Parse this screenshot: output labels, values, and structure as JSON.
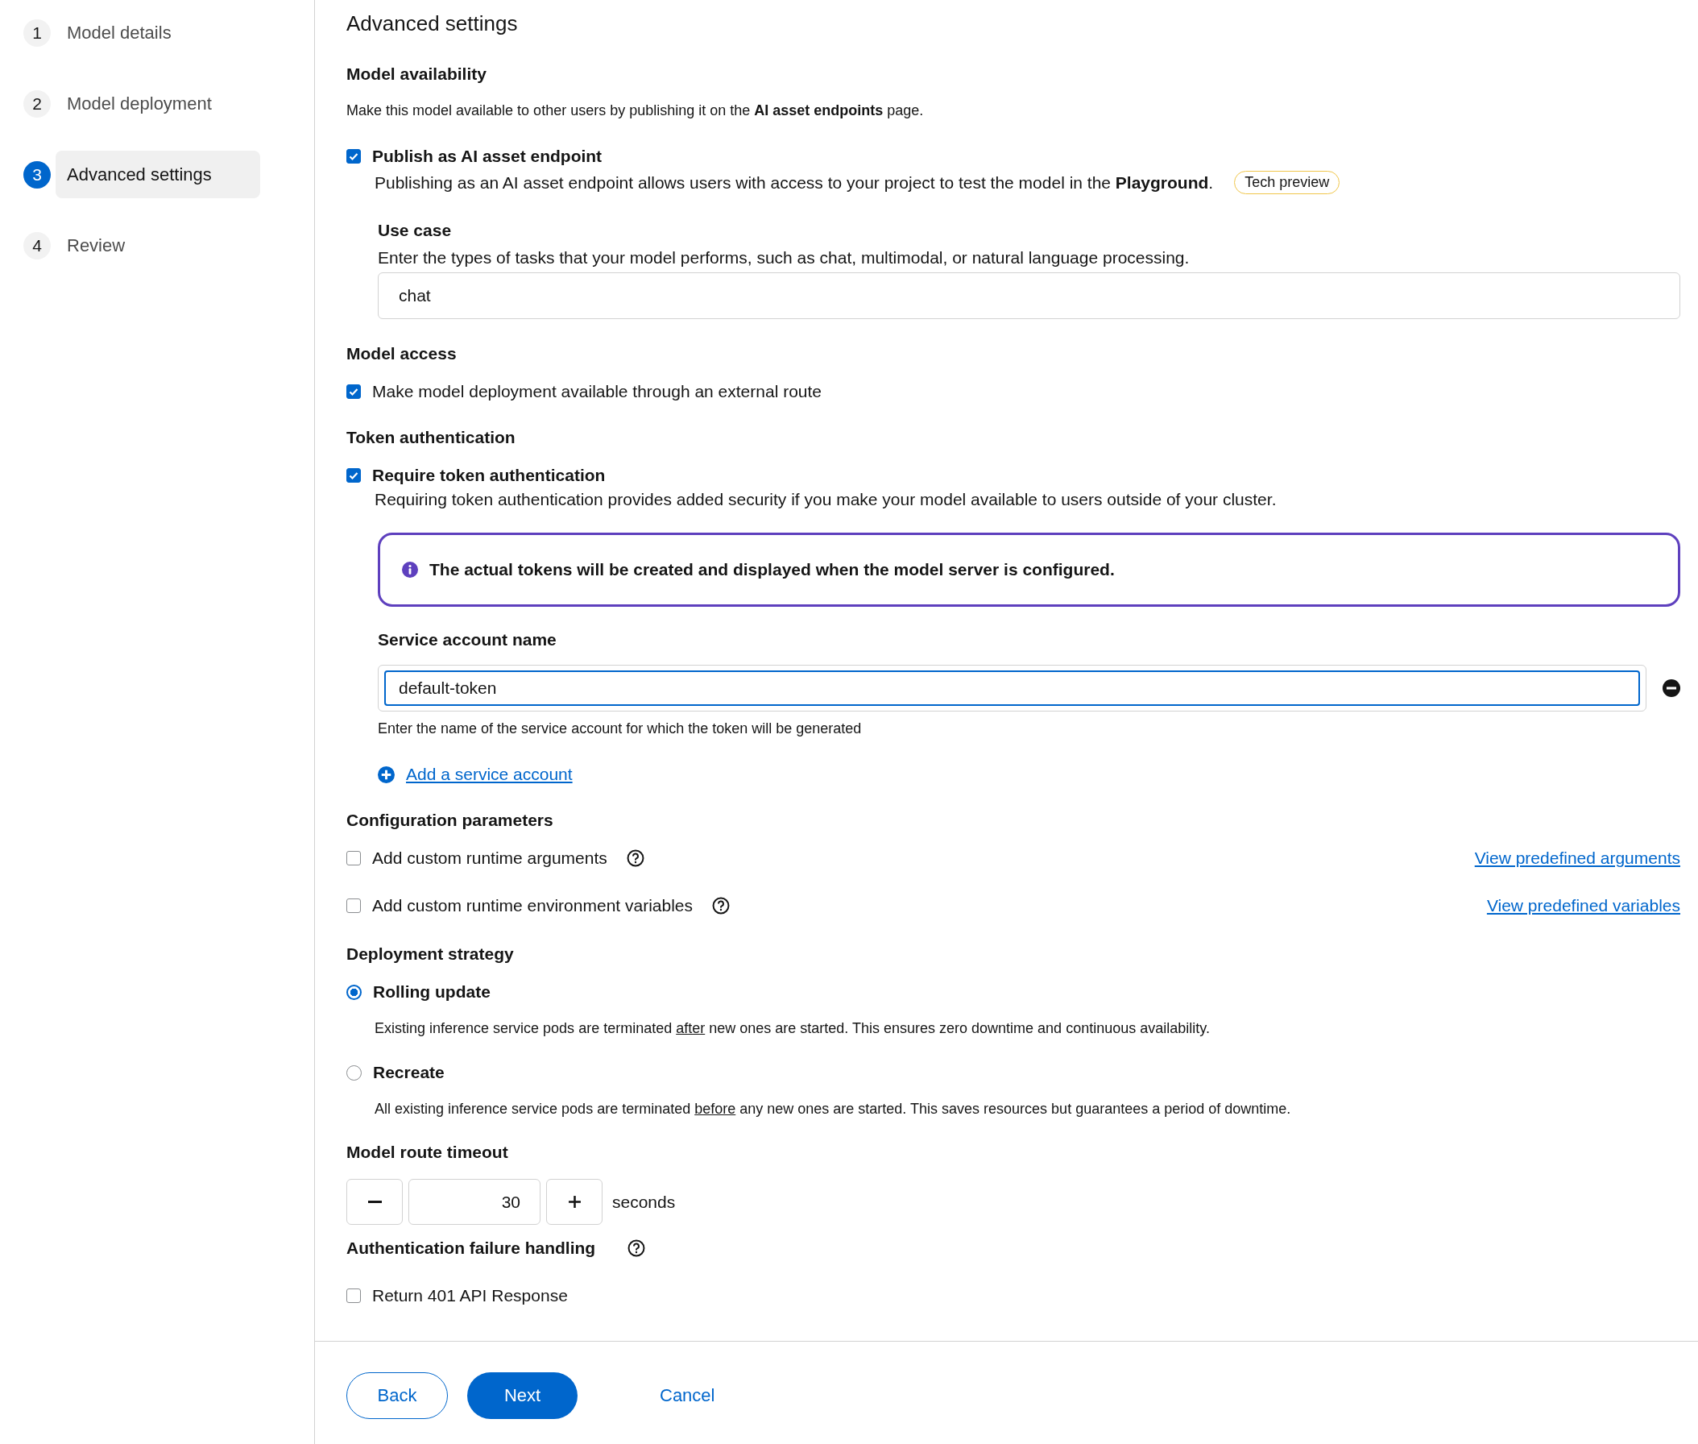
{
  "steps": [
    {
      "number": "1",
      "label": "Model details",
      "selected": false
    },
    {
      "number": "2",
      "label": "Model deployment",
      "selected": false
    },
    {
      "number": "3",
      "label": "Advanced settings",
      "selected": true
    },
    {
      "number": "4",
      "label": "Review",
      "selected": false
    }
  ],
  "title": "Advanced settings",
  "model_availability": {
    "heading": "Model availability",
    "description": "Make this model available to other users by publishing it on the **AI asset endpoints** page.",
    "publish": {
      "label": "Publish as AI asset endpoint",
      "checked": true,
      "description": "Publishing as an AI asset endpoint allows users with access to your project to test the model in the **Playground**.",
      "badge": "Tech preview",
      "use_case": {
        "label": "Use case",
        "description": "Enter the types of tasks that your model performs, such as chat, multimodal, or natural language processing.",
        "value": "chat"
      }
    }
  },
  "model_access": {
    "heading": "Model access",
    "option": {
      "label": "Make model deployment available through an external route",
      "checked": true
    }
  },
  "token_authentication": {
    "heading": "Token authentication",
    "option": {
      "label": "Require token authentication",
      "checked": true,
      "description": "Requiring token authentication provides added security if you make your model available to users outside of your cluster."
    },
    "alert": "The actual tokens will be created and displayed when the model server is configured.",
    "service_account": {
      "label": "Service account name",
      "value": "default-token",
      "helper": "Enter the name of the service account for which the token will be generated"
    },
    "add_link": "Add a service account"
  },
  "configuration_parameters": {
    "heading": "Configuration parameters",
    "options": [
      {
        "label": "Add custom runtime arguments",
        "checked": false,
        "link": "View predefined arguments"
      },
      {
        "label": "Add custom runtime environment variables",
        "checked": false,
        "link": "View predefined variables"
      }
    ]
  },
  "deployment_strategy": {
    "heading": "Deployment strategy",
    "options": [
      {
        "label": "Rolling update",
        "selected": true,
        "description_before": "Existing inference service pods are terminated",
        "description_underlined": "after",
        "description_after": "new ones are started. This ensures zero downtime and continuous availability."
      },
      {
        "label": "Recreate",
        "selected": false,
        "description_before": "All existing inference service pods are terminated",
        "description_underlined": "before",
        "description_after": "any new ones are started. This saves resources but guarantees a period of downtime."
      }
    ]
  },
  "route_timeout": {
    "heading": "Model route timeout",
    "value": "30",
    "unit": "seconds"
  },
  "auth_failure": {
    "heading": "Authentication failure handling",
    "option": {
      "label": "Return 401 API Response",
      "checked": false
    }
  },
  "buttons": {
    "back": "Back",
    "next": "Next",
    "cancel": "Cancel"
  }
}
